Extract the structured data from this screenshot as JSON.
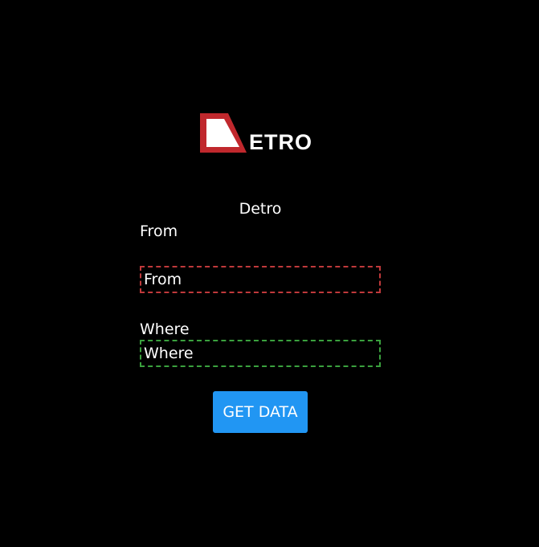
{
  "logo": {
    "text": "ETRO",
    "accent_color": "#c0282d"
  },
  "app": {
    "title": "Detro"
  },
  "form": {
    "from": {
      "label": "From",
      "placeholder": "From",
      "border_color": "#c0393b"
    },
    "where": {
      "label": "Where",
      "placeholder": "Where",
      "border_color": "#3aa13e"
    },
    "submit_label": "GET DATA",
    "submit_color": "#2196f3"
  }
}
